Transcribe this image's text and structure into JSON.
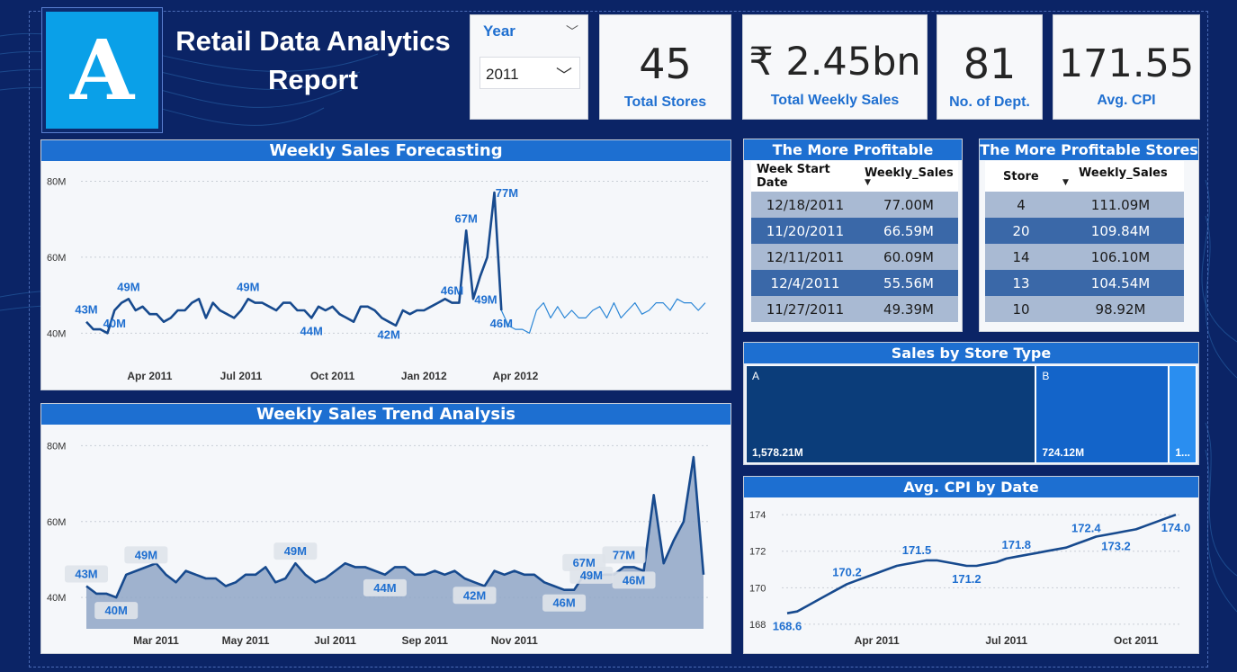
{
  "header": {
    "logo_letter": "A",
    "title_line1": "Retail Data Analytics",
    "title_line2": "Report"
  },
  "slicer": {
    "label": "Year",
    "value": "2011"
  },
  "kpis": [
    {
      "value": "45",
      "caption": "Total Stores"
    },
    {
      "value": "₹ 2.45bn",
      "caption": "Total Weekly Sales"
    },
    {
      "value": "81",
      "caption": "No. of Dept."
    },
    {
      "value": "171.55",
      "caption": "Avg. CPI"
    }
  ],
  "profitable_weeks": {
    "title": "The More Profitable Weeks",
    "columns": [
      "Week Start Date",
      "Weekly_Sales"
    ],
    "rows": [
      [
        "12/18/2011",
        "77.00M"
      ],
      [
        "11/20/2011",
        "66.59M"
      ],
      [
        "12/11/2011",
        "60.09M"
      ],
      [
        "12/4/2011",
        "55.56M"
      ],
      [
        "11/27/2011",
        "49.39M"
      ]
    ]
  },
  "profitable_stores": {
    "title": "The More Profitable Stores",
    "columns": [
      "Store",
      "Weekly_Sales"
    ],
    "rows": [
      [
        "4",
        "111.09M"
      ],
      [
        "20",
        "109.84M"
      ],
      [
        "14",
        "106.10M"
      ],
      [
        "13",
        "104.54M"
      ],
      [
        "10",
        "98.92M"
      ]
    ]
  },
  "colors": {
    "navy": "#0b2466",
    "accent": "#1d6fd1",
    "line": "#174a8e",
    "forecast": "#2b86d6",
    "type_a": "#0b3d7a",
    "type_b": "#1364c9",
    "type_c": "#2a8ef0"
  },
  "chart_data": [
    {
      "id": "forecast",
      "type": "line",
      "title": "Weekly Sales Forecasting",
      "x_ticks": [
        "Apr 2011",
        "Jul 2011",
        "Oct 2011",
        "Jan 2012",
        "Apr 2012"
      ],
      "x_tick_index": [
        9,
        22,
        35,
        48,
        61
      ],
      "y_ticks": [
        "40M",
        "60M",
        "80M"
      ],
      "y_tick_values": [
        40,
        60,
        80
      ],
      "ylim": [
        37,
        82
      ],
      "series": [
        {
          "values": [
            43,
            41,
            41,
            40,
            46,
            48,
            49,
            46,
            47,
            45,
            45,
            43,
            44,
            46,
            46,
            48,
            49,
            44,
            48,
            46,
            45,
            44,
            46,
            49,
            48,
            48,
            47,
            46,
            48,
            48,
            46,
            46,
            44,
            47,
            46,
            47,
            45,
            44,
            43,
            47,
            47,
            46,
            44,
            43,
            42,
            46,
            45,
            46,
            46,
            47,
            48,
            49,
            48,
            48,
            67,
            49,
            55,
            60,
            77,
            46
          ],
          "labels": [
            [
              0,
              "43M",
              "above"
            ],
            [
              4,
              "40M",
              "below"
            ],
            [
              6,
              "49M",
              "above"
            ],
            [
              23,
              "49M",
              "above"
            ],
            [
              32,
              "44M",
              "below"
            ],
            [
              43,
              "42M",
              "below"
            ],
            [
              52,
              "46M",
              "above"
            ],
            [
              54,
              "67M",
              "above"
            ],
            [
              55,
              "49M",
              "right"
            ],
            [
              58,
              "77M",
              "right"
            ],
            [
              59,
              "46M",
              "below"
            ]
          ]
        },
        {
          "start_index": 59,
          "values": [
            46,
            42,
            41,
            41,
            40,
            46,
            48,
            44,
            47,
            44,
            46,
            44,
            44,
            46,
            47,
            44,
            48,
            44,
            46,
            48,
            45,
            46,
            48,
            48,
            46,
            49,
            48,
            48,
            46,
            48
          ]
        }
      ]
    },
    {
      "id": "trend",
      "type": "area",
      "title": "Weekly Sales Trend Analysis",
      "x_ticks": [
        "Mar 2011",
        "May 2011",
        "Jul 2011",
        "Sep 2011",
        "Nov 2011"
      ],
      "x_tick_index": [
        7,
        16,
        25,
        34,
        43
      ],
      "y_ticks": [
        "40M",
        "60M",
        "80M"
      ],
      "y_tick_values": [
        40,
        60,
        80
      ],
      "ylim": [
        36,
        82
      ],
      "series": [
        {
          "values": [
            43,
            41,
            41,
            40,
            46,
            47,
            48,
            49,
            46,
            44,
            47,
            46,
            45,
            45,
            43,
            44,
            46,
            46,
            48,
            44,
            45,
            49,
            46,
            44,
            45,
            47,
            49,
            48,
            48,
            47,
            46,
            48,
            48,
            46,
            46,
            47,
            46,
            47,
            45,
            44,
            43,
            47,
            46,
            47,
            46,
            46,
            44,
            43,
            42,
            42,
            46,
            45,
            46,
            46,
            48,
            48,
            47,
            67,
            49,
            55,
            60,
            77,
            46
          ],
          "labels": [
            [
              0,
              "43M",
              "above"
            ],
            [
              3,
              "40M",
              "below"
            ],
            [
              6,
              "49M",
              "above"
            ],
            [
              21,
              "49M",
              "above"
            ],
            [
              30,
              "44M",
              "below"
            ],
            [
              39,
              "42M",
              "below"
            ],
            [
              48,
              "46M",
              "below"
            ],
            [
              50,
              "67M",
              "above"
            ],
            [
              52,
              "49M",
              "left"
            ],
            [
              54,
              "77M",
              "above"
            ],
            [
              55,
              "46M",
              "below"
            ]
          ]
        }
      ]
    },
    {
      "id": "store-type",
      "type": "treemap",
      "title": "Sales by Store Type",
      "categories": [
        "A",
        "B",
        ""
      ],
      "values": [
        1578.21,
        724.12,
        150
      ],
      "value_labels": [
        "1,578.21M",
        "724.12M",
        "1..."
      ]
    },
    {
      "id": "cpi",
      "type": "line",
      "title": "Avg. CPI by Date",
      "x_ticks": [
        "Apr 2011",
        "Jul 2011",
        "Oct 2011"
      ],
      "x_tick_index": [
        9,
        22,
        35
      ],
      "y_ticks": [
        "168",
        "170",
        "172",
        "174"
      ],
      "y_tick_values": [
        168,
        170,
        172,
        174
      ],
      "ylim": [
        167.6,
        174.6
      ],
      "series": [
        {
          "values": [
            168.6,
            168.7,
            169.0,
            169.3,
            169.6,
            169.9,
            170.2,
            170.4,
            170.6,
            170.8,
            171.0,
            171.2,
            171.3,
            171.4,
            171.5,
            171.5,
            171.4,
            171.3,
            171.2,
            171.2,
            171.3,
            171.4,
            171.6,
            171.7,
            171.8,
            171.9,
            172.0,
            172.1,
            172.2,
            172.4,
            172.6,
            172.8,
            172.9,
            173.0,
            173.1,
            173.2,
            173.4,
            173.6,
            173.8,
            174.0
          ],
          "labels": [
            [
              0,
              "168.6",
              "below"
            ],
            [
              6,
              "170.2",
              "above"
            ],
            [
              13,
              "171.5",
              "above"
            ],
            [
              18,
              "171.2",
              "below"
            ],
            [
              23,
              "171.8",
              "above"
            ],
            [
              30,
              "172.4",
              "above"
            ],
            [
              33,
              "173.2",
              "below"
            ],
            [
              39,
              "174.0",
              "below"
            ]
          ]
        }
      ]
    }
  ]
}
